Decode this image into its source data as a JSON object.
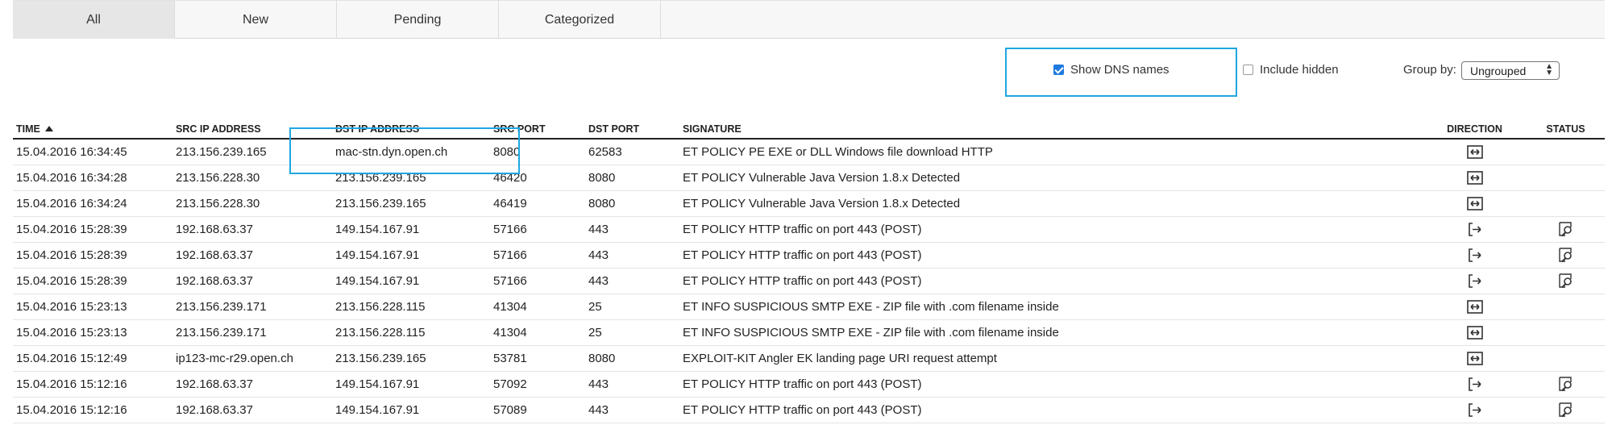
{
  "tabs": [
    {
      "label": "All",
      "active": true
    },
    {
      "label": "New",
      "active": false
    },
    {
      "label": "Pending",
      "active": false
    },
    {
      "label": "Categorized",
      "active": false
    }
  ],
  "toolbar": {
    "show_dns": {
      "label": "Show DNS names",
      "checked": true
    },
    "include_hidden": {
      "label": "Include hidden",
      "checked": false
    },
    "group_by": {
      "label": "Group by:",
      "value": "Ungrouped"
    }
  },
  "columns": [
    "TIME",
    "SRC IP ADDRESS",
    "DST IP ADDRESS",
    "SRC PORT",
    "DST PORT",
    "SIGNATURE",
    "DIRECTION",
    "STATUS"
  ],
  "icons": {
    "sort": "sort-ascending-icon",
    "bidirectional": "bidirectional-arrow-icon",
    "outbound": "outbound-arrow-icon",
    "status": "inspect-magnifier-icon"
  },
  "colors": {
    "highlight": "#1ea7e0",
    "checkbox": "#1f7ae0"
  },
  "rows": [
    {
      "time": "15.04.2016 16:34:45",
      "src": "213.156.239.165",
      "dst": "mac-stn.dyn.open.ch",
      "sport": "8080",
      "dport": "62583",
      "sig": "ET POLICY PE EXE or DLL Windows file download HTTP",
      "dir": "bidirectional",
      "status": false
    },
    {
      "time": "15.04.2016 16:34:28",
      "src": "213.156.228.30",
      "dst": "213.156.239.165",
      "sport": "46420",
      "dport": "8080",
      "sig": "ET POLICY Vulnerable Java Version 1.8.x Detected",
      "dir": "bidirectional",
      "status": false
    },
    {
      "time": "15.04.2016 16:34:24",
      "src": "213.156.228.30",
      "dst": "213.156.239.165",
      "sport": "46419",
      "dport": "8080",
      "sig": "ET POLICY Vulnerable Java Version 1.8.x Detected",
      "dir": "bidirectional",
      "status": false
    },
    {
      "time": "15.04.2016 15:28:39",
      "src": "192.168.63.37",
      "dst": "149.154.167.91",
      "sport": "57166",
      "dport": "443",
      "sig": "ET POLICY HTTP traffic on port 443 (POST)",
      "dir": "outbound",
      "status": true
    },
    {
      "time": "15.04.2016 15:28:39",
      "src": "192.168.63.37",
      "dst": "149.154.167.91",
      "sport": "57166",
      "dport": "443",
      "sig": "ET POLICY HTTP traffic on port 443 (POST)",
      "dir": "outbound",
      "status": true
    },
    {
      "time": "15.04.2016 15:28:39",
      "src": "192.168.63.37",
      "dst": "149.154.167.91",
      "sport": "57166",
      "dport": "443",
      "sig": "ET POLICY HTTP traffic on port 443 (POST)",
      "dir": "outbound",
      "status": true
    },
    {
      "time": "15.04.2016 15:23:13",
      "src": "213.156.239.171",
      "dst": "213.156.228.115",
      "sport": "41304",
      "dport": "25",
      "sig": "ET INFO SUSPICIOUS SMTP EXE - ZIP file with .com filename inside",
      "dir": "bidirectional",
      "status": false
    },
    {
      "time": "15.04.2016 15:23:13",
      "src": "213.156.239.171",
      "dst": "213.156.228.115",
      "sport": "41304",
      "dport": "25",
      "sig": "ET INFO SUSPICIOUS SMTP EXE - ZIP file with .com filename inside",
      "dir": "bidirectional",
      "status": false
    },
    {
      "time": "15.04.2016 15:12:49",
      "src": "ip123-mc-r29.open.ch",
      "dst": "213.156.239.165",
      "sport": "53781",
      "dport": "8080",
      "sig": "EXPLOIT-KIT Angler EK landing page URI request attempt",
      "dir": "bidirectional",
      "status": false
    },
    {
      "time": "15.04.2016 15:12:16",
      "src": "192.168.63.37",
      "dst": "149.154.167.91",
      "sport": "57092",
      "dport": "443",
      "sig": "ET POLICY HTTP traffic on port 443 (POST)",
      "dir": "outbound",
      "status": true
    },
    {
      "time": "15.04.2016 15:12:16",
      "src": "192.168.63.37",
      "dst": "149.154.167.91",
      "sport": "57089",
      "dport": "443",
      "sig": "ET POLICY HTTP traffic on port 443 (POST)",
      "dir": "outbound",
      "status": true
    }
  ]
}
